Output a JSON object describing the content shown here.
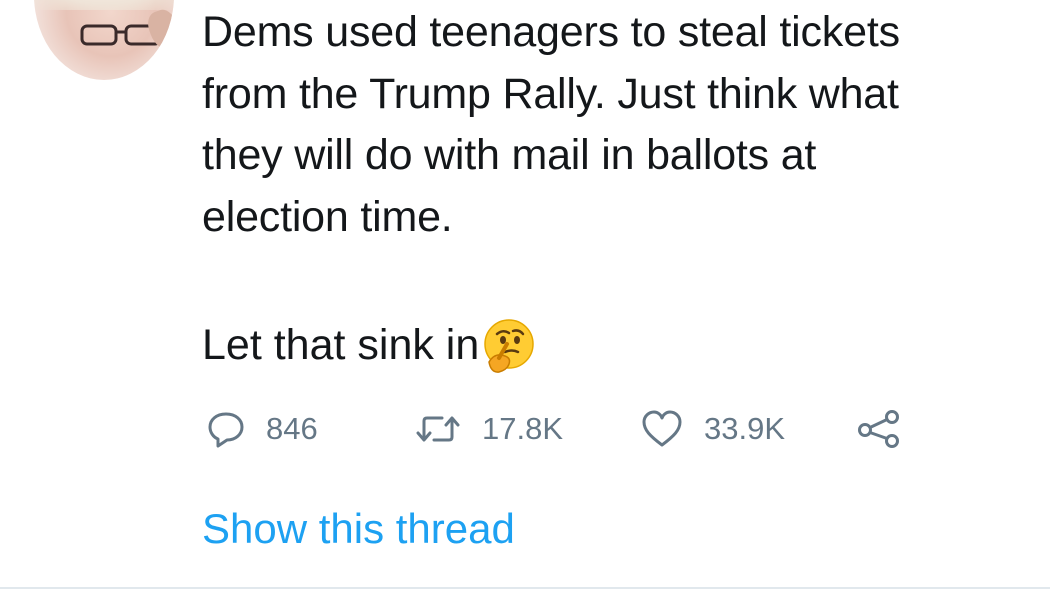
{
  "tweet": {
    "text_lines": [
      "Dems used teenagers to steal tickets",
      "from the Trump Rally. Just think what",
      "they will do with mail in ballots at",
      "election time."
    ],
    "closing_text": "Let that sink in",
    "closing_emoji": "thinking-face-icon"
  },
  "actions": {
    "reply": {
      "icon": "reply-icon",
      "count": "846"
    },
    "retweet": {
      "icon": "retweet-icon",
      "count": "17.8K"
    },
    "like": {
      "icon": "heart-icon",
      "count": "33.9K"
    },
    "share": {
      "icon": "share-icon"
    }
  },
  "show_thread_label": "Show this thread",
  "colors": {
    "text": "#14171a",
    "muted": "#657786",
    "link": "#1da1f2",
    "divider": "#e1e8ed"
  }
}
